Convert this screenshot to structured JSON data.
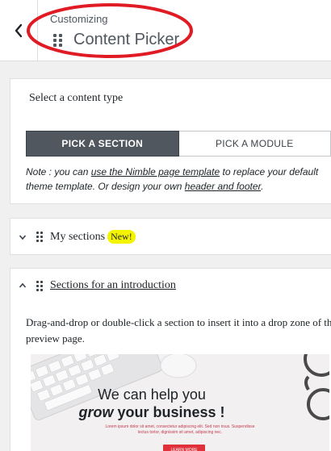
{
  "header": {
    "subtitle": "Customizing",
    "title": "Content Picker"
  },
  "content_type": {
    "label": "Select a content type",
    "buttons": [
      "PICK A SECTION",
      "PICK A MODULE"
    ],
    "selected": "PICK A SECTION",
    "note_prefix": "Note : you can ",
    "note_link1": "use the Nimble page template",
    "note_mid": " to replace your default",
    "note_line2_prefix": "theme template. Or design your own ",
    "note_link2": "header and footer",
    "note_suffix": "."
  },
  "my_sections": {
    "label": "My sections",
    "badge": "New!",
    "expanded": false
  },
  "intro_sections": {
    "label": "Sections for an introduction",
    "expanded": true,
    "description": "Drag-and-drop or double-click a section to insert it into a drop zone of the preview page.",
    "preview": {
      "line1": "We can help you",
      "line2_emph": "grow",
      "line2_rest": " your business !",
      "body": "Lorem ipsum dolor sit amet, consectetur adipiscing elit. Sed non risus. Suspendisse lectus tortor, dignissim sit amet, adipiscing nec.",
      "cta": "LEARN MORE"
    }
  },
  "colors": {
    "active_button": "#51575e",
    "badge": "#f4f400",
    "annotation": "#e01b24",
    "cta": "#e0313b"
  }
}
